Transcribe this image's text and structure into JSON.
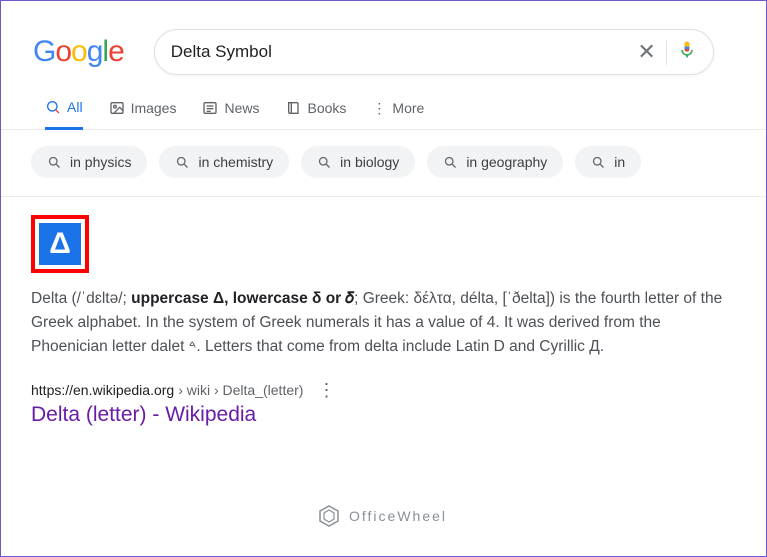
{
  "search": {
    "query": "Delta Symbol"
  },
  "tabs": {
    "all": "All",
    "images": "Images",
    "news": "News",
    "books": "Books",
    "more": "More"
  },
  "chips": {
    "c0": "in physics",
    "c1": "in chemistry",
    "c2": "in biology",
    "c3": "in geography",
    "c4": "in"
  },
  "result": {
    "delta_glyph": "Δ",
    "snippet_lead": "Delta (/ˈdɛltə/; ",
    "snippet_bold": "uppercase Δ, lowercase δ or 𝛿",
    "snippet_tail": "; Greek: δέλτα, délta, [ˈðelta]) is the fourth letter of the Greek alphabet. In the system of Greek numerals it has a value of 4. It was derived from the Phoenician letter dalet 𐤃. Letters that come from delta include Latin D and Cyrillic Д.",
    "url_host": "https://en.wikipedia.org",
    "url_path": " › wiki › Delta_(letter)",
    "title": "Delta (letter) - Wikipedia"
  },
  "watermark": "OfficeWheel"
}
